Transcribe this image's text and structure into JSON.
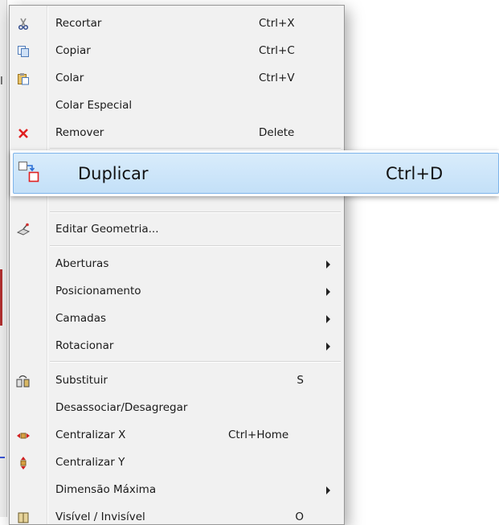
{
  "background": {
    "fragment_text": "I"
  },
  "menu": {
    "items": [
      {
        "label": "Recortar",
        "shortcut": "Ctrl+X",
        "icon": "scissors-icon"
      },
      {
        "label": "Copiar",
        "shortcut": "Ctrl+C",
        "icon": "copy-icon"
      },
      {
        "label": "Colar",
        "shortcut": "Ctrl+V",
        "icon": "paste-icon"
      },
      {
        "label": "Colar Especial",
        "shortcut": "",
        "icon": ""
      },
      {
        "label": "Remover",
        "shortcut": "Delete",
        "icon": "delete-x-icon"
      },
      {
        "label": "Duplicar",
        "shortcut": "Ctrl+D",
        "icon": "duplicate-icon"
      },
      {
        "label": "Editar Geometria...",
        "shortcut": "",
        "icon": "edit-geometry-icon"
      },
      {
        "label": "Aberturas",
        "shortcut": "",
        "submenu": true
      },
      {
        "label": "Posicionamento",
        "shortcut": "",
        "submenu": true
      },
      {
        "label": "Camadas",
        "shortcut": "",
        "submenu": true
      },
      {
        "label": "Rotacionar",
        "shortcut": "",
        "submenu": true
      },
      {
        "label": "Substituir",
        "shortcut": "S",
        "icon": "replace-icon"
      },
      {
        "label": "Desassociar/Desagregar",
        "shortcut": "",
        "icon": ""
      },
      {
        "label": "Centralizar X",
        "shortcut": "Ctrl+Home",
        "icon": "center-x-icon"
      },
      {
        "label": "Centralizar Y",
        "shortcut": "",
        "icon": "center-y-icon"
      },
      {
        "label": "Dimensão Máxima",
        "shortcut": "",
        "submenu": true
      },
      {
        "label": "Visível / Invisível",
        "shortcut": "O",
        "icon": "visibility-icon"
      }
    ],
    "highlighted": {
      "label": "Duplicar",
      "shortcut": "Ctrl+D"
    }
  },
  "colors": {
    "highlight": "#c3e0f8",
    "highlight_border": "#7eb4ea",
    "delete_red": "#e02020"
  }
}
